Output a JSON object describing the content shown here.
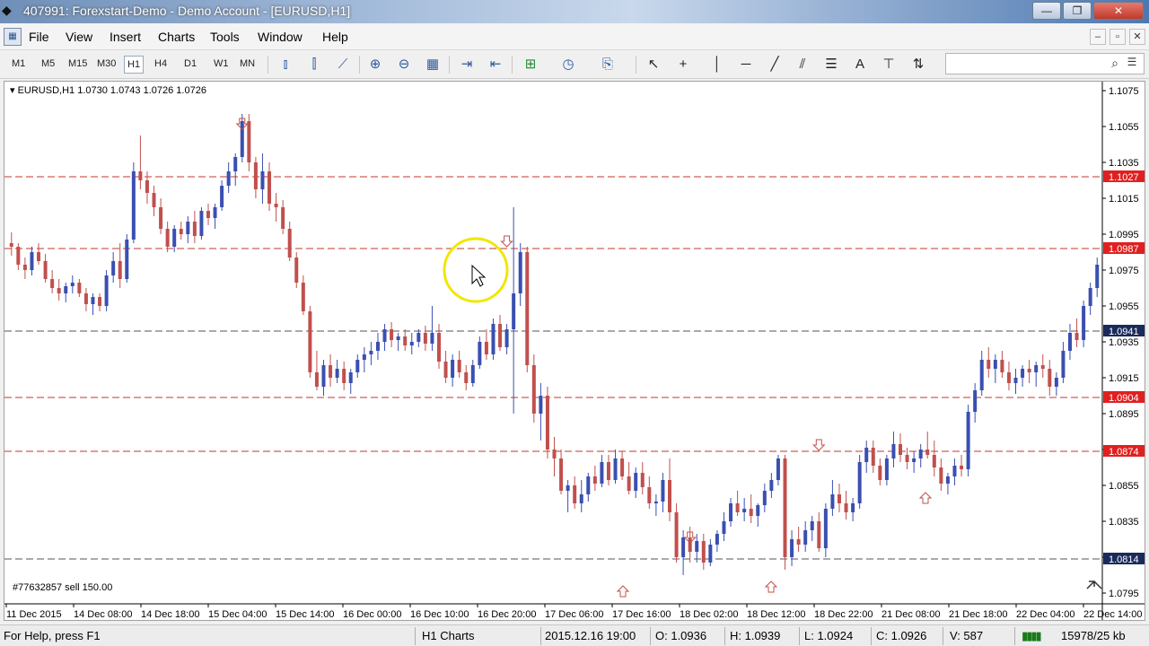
{
  "window": {
    "title": "407991: Forexstart-Demo - Demo Account - [EURUSD,H1]",
    "minimize": "—",
    "maximize": "❐",
    "close": "✕"
  },
  "menu": {
    "items": [
      "File",
      "View",
      "Insert",
      "Charts",
      "Tools",
      "Window",
      "Help"
    ],
    "mdi": [
      "–",
      "▫",
      "✕"
    ]
  },
  "toolbar": {
    "timeframes": [
      "M1",
      "M5",
      "M15",
      "M30",
      "H1",
      "H4",
      "D1",
      "W1",
      "MN"
    ],
    "active_timeframe": "H1",
    "search_placeholder": ""
  },
  "chart": {
    "info": "EURUSD,H1  1.0730 1.0743 1.0726 1.0726",
    "trade_label": "#77632857 sell 150.00",
    "colors": {
      "bull": "#3a4fb0",
      "bear": "#c0504d",
      "hline_red": "#c0392b",
      "hline_dark": "#555555",
      "price_red_bg": "#e02020",
      "price_dark_bg": "#1a2a5a",
      "cursor_circle": "#f2e600"
    }
  },
  "chart_data": {
    "type": "candlestick",
    "symbol": "EURUSD",
    "timeframe": "H1",
    "ylim": [
      1.0795,
      1.1075
    ],
    "y_ticks": [
      "1.1075",
      "1.1055",
      "1.1035",
      "1.1015",
      "1.0995",
      "1.0975",
      "1.0955",
      "1.0935",
      "1.0915",
      "1.0895",
      "1.0875",
      "1.0855",
      "1.0835",
      "1.0815",
      "1.0795"
    ],
    "x_ticks": [
      "11 Dec 2015",
      "14 Dec 08:00",
      "14 Dec 18:00",
      "15 Dec 04:00",
      "15 Dec 14:00",
      "16 Dec 00:00",
      "16 Dec 10:00",
      "16 Dec 20:00",
      "17 Dec 06:00",
      "17 Dec 16:00",
      "18 Dec 02:00",
      "18 Dec 12:00",
      "18 Dec 22:00",
      "21 Dec 08:00",
      "21 Dec 18:00",
      "22 Dec 04:00",
      "22 Dec 14:00"
    ],
    "horizontal_lines": [
      {
        "price": "1.1027",
        "style": "red"
      },
      {
        "price": "1.0987",
        "style": "red"
      },
      {
        "price": "1.0941",
        "style": "dark"
      },
      {
        "price": "1.0904",
        "style": "red"
      },
      {
        "price": "1.0874",
        "style": "red"
      },
      {
        "price": "1.0814",
        "style": "dark"
      }
    ],
    "candles": [
      [
        1.099,
        1.0996,
        1.0983,
        1.0988
      ],
      [
        1.0988,
        1.099,
        1.0975,
        1.0978
      ],
      [
        1.0978,
        1.0982,
        1.097,
        1.0975
      ],
      [
        1.0975,
        1.0988,
        1.0972,
        1.0985
      ],
      [
        1.0985,
        1.099,
        1.0978,
        1.098
      ],
      [
        1.098,
        1.0984,
        1.0968,
        1.097
      ],
      [
        1.097,
        1.0975,
        1.0962,
        1.0965
      ],
      [
        1.0965,
        1.097,
        1.0958,
        1.0962
      ],
      [
        1.0962,
        1.0968,
        1.0957,
        1.0966
      ],
      [
        1.0966,
        1.0972,
        1.0962,
        1.0968
      ],
      [
        1.0968,
        1.097,
        1.096,
        1.0962
      ],
      [
        1.0962,
        1.0965,
        1.0952,
        1.0956
      ],
      [
        1.0956,
        1.0962,
        1.095,
        1.096
      ],
      [
        1.096,
        1.0962,
        1.0952,
        1.0955
      ],
      [
        1.0955,
        1.0975,
        1.0952,
        1.0972
      ],
      [
        1.0972,
        1.0985,
        1.0968,
        1.098
      ],
      [
        1.098,
        1.099,
        1.0965,
        1.097
      ],
      [
        1.097,
        1.0995,
        1.0968,
        1.0992
      ],
      [
        1.0992,
        1.1035,
        1.099,
        1.103
      ],
      [
        1.103,
        1.105,
        1.102,
        1.1025
      ],
      [
        1.1025,
        1.103,
        1.1012,
        1.1018
      ],
      [
        1.1018,
        1.1022,
        1.1005,
        1.101
      ],
      [
        1.101,
        1.1015,
        1.0995,
        1.0998
      ],
      [
        1.0998,
        1.1002,
        1.0985,
        1.0988
      ],
      [
        1.0988,
        1.1,
        1.0985,
        1.0998
      ],
      [
        1.0998,
        1.1002,
        1.0992,
        1.0995
      ],
      [
        1.0995,
        1.1005,
        1.099,
        1.1002
      ],
      [
        1.1002,
        1.1008,
        1.099,
        1.0994
      ],
      [
        1.0994,
        1.101,
        1.0992,
        1.1008
      ],
      [
        1.1008,
        1.1012,
        1.1,
        1.1004
      ],
      [
        1.1004,
        1.1012,
        1.0998,
        1.101
      ],
      [
        1.101,
        1.1025,
        1.1008,
        1.1022
      ],
      [
        1.1022,
        1.1035,
        1.1018,
        1.103
      ],
      [
        1.103,
        1.104,
        1.1022,
        1.1038
      ],
      [
        1.1038,
        1.1062,
        1.1035,
        1.1058
      ],
      [
        1.1058,
        1.1062,
        1.103,
        1.1035
      ],
      [
        1.1035,
        1.1038,
        1.1015,
        1.102
      ],
      [
        1.102,
        1.104,
        1.1012,
        1.103
      ],
      [
        1.103,
        1.1035,
        1.1008,
        1.1012
      ],
      [
        1.1012,
        1.1018,
        1.1002,
        1.101
      ],
      [
        1.101,
        1.1014,
        1.0995,
        1.0998
      ],
      [
        1.0998,
        1.1002,
        1.098,
        1.0982
      ],
      [
        1.0982,
        1.0985,
        1.0965,
        1.0968
      ],
      [
        1.0968,
        1.0972,
        1.095,
        1.0952
      ],
      [
        1.0952,
        1.0955,
        1.0915,
        1.0918
      ],
      [
        1.0918,
        1.093,
        1.0908,
        1.091
      ],
      [
        1.091,
        1.0925,
        1.0905,
        1.0922
      ],
      [
        1.0922,
        1.0928,
        1.091,
        1.0915
      ],
      [
        1.0915,
        1.0925,
        1.0912,
        1.092
      ],
      [
        1.092,
        1.0924,
        1.0908,
        1.0912
      ],
      [
        1.0912,
        1.092,
        1.0906,
        1.0918
      ],
      [
        1.0918,
        1.0928,
        1.0915,
        1.0925
      ],
      [
        1.0925,
        1.0932,
        1.0918,
        1.0928
      ],
      [
        1.0928,
        1.0935,
        1.0922,
        1.093
      ],
      [
        1.093,
        1.094,
        1.0925,
        1.0935
      ],
      [
        1.0935,
        1.0945,
        1.093,
        1.0942
      ],
      [
        1.0942,
        1.0946,
        1.0932,
        1.0936
      ],
      [
        1.0936,
        1.094,
        1.093,
        1.0938
      ],
      [
        1.0938,
        1.0942,
        1.093,
        1.0933
      ],
      [
        1.0933,
        1.094,
        1.0928,
        1.0935
      ],
      [
        1.0935,
        1.0942,
        1.0932,
        1.094
      ],
      [
        1.094,
        1.0944,
        1.093,
        1.0934
      ],
      [
        1.0934,
        1.0955,
        1.093,
        1.094
      ],
      [
        1.094,
        1.0945,
        1.092,
        1.0924
      ],
      [
        1.0924,
        1.093,
        1.0912,
        1.0915
      ],
      [
        1.0915,
        1.0928,
        1.091,
        1.0925
      ],
      [
        1.0925,
        1.093,
        1.0915,
        1.0918
      ],
      [
        1.0918,
        1.0922,
        1.0908,
        1.0912
      ],
      [
        1.0912,
        1.0925,
        1.091,
        1.0922
      ],
      [
        1.0922,
        1.0938,
        1.092,
        1.0935
      ],
      [
        1.0935,
        1.0942,
        1.0925,
        1.0928
      ],
      [
        1.0928,
        1.0948,
        1.0925,
        1.0945
      ],
      [
        1.0945,
        1.095,
        1.093,
        1.0932
      ],
      [
        1.0932,
        1.0945,
        1.0928,
        1.0942
      ],
      [
        1.0942,
        1.101,
        1.0895,
        1.0962
      ],
      [
        1.0962,
        1.099,
        1.0955,
        1.0985
      ],
      [
        1.0985,
        1.0988,
        1.0918,
        1.0922
      ],
      [
        1.0922,
        1.0928,
        1.089,
        1.0895
      ],
      [
        1.0895,
        1.0912,
        1.088,
        1.0905
      ],
      [
        1.0905,
        1.091,
        1.087,
        1.0875
      ],
      [
        1.0875,
        1.0882,
        1.086,
        1.087
      ],
      [
        1.087,
        1.0875,
        1.085,
        1.0852
      ],
      [
        1.0852,
        1.0858,
        1.084,
        1.0855
      ],
      [
        1.0855,
        1.086,
        1.0842,
        1.0845
      ],
      [
        1.0845,
        1.0858,
        1.084,
        1.085
      ],
      [
        1.085,
        1.0862,
        1.0846,
        1.086
      ],
      [
        1.086,
        1.0866,
        1.0852,
        1.0856
      ],
      [
        1.0856,
        1.0872,
        1.0854,
        1.0868
      ],
      [
        1.0868,
        1.0872,
        1.0855,
        1.0858
      ],
      [
        1.0858,
        1.0875,
        1.0856,
        1.087
      ],
      [
        1.087,
        1.0874,
        1.0858,
        1.086
      ],
      [
        1.086,
        1.0868,
        1.085,
        1.0852
      ],
      [
        1.0852,
        1.0865,
        1.0848,
        1.0862
      ],
      [
        1.0862,
        1.0868,
        1.085,
        1.0854
      ],
      [
        1.0854,
        1.086,
        1.0842,
        1.0845
      ],
      [
        1.0845,
        1.085,
        1.0838,
        1.0846
      ],
      [
        1.0846,
        1.0862,
        1.084,
        1.0858
      ],
      [
        1.0858,
        1.087,
        1.0835,
        1.084
      ],
      [
        1.084,
        1.0845,
        1.0812,
        1.0815
      ],
      [
        1.0815,
        1.083,
        1.0805,
        1.0826
      ],
      [
        1.0826,
        1.0832,
        1.0812,
        1.0818
      ],
      [
        1.0818,
        1.0828,
        1.0812,
        1.0824
      ],
      [
        1.0824,
        1.0828,
        1.0808,
        1.0812
      ],
      [
        1.0812,
        1.0825,
        1.081,
        1.0822
      ],
      [
        1.0822,
        1.083,
        1.0818,
        1.0828
      ],
      [
        1.0828,
        1.084,
        1.0824,
        1.0835
      ],
      [
        1.0835,
        1.0848,
        1.0832,
        1.0845
      ],
      [
        1.0845,
        1.0852,
        1.0838,
        1.084
      ],
      [
        1.084,
        1.0848,
        1.0835,
        1.0842
      ],
      [
        1.0842,
        1.085,
        1.0834,
        1.0838
      ],
      [
        1.0838,
        1.0845,
        1.0832,
        1.0844
      ],
      [
        1.0844,
        1.0856,
        1.084,
        1.0852
      ],
      [
        1.0852,
        1.0862,
        1.0848,
        1.0858
      ],
      [
        1.0858,
        1.0872,
        1.0855,
        1.087
      ],
      [
        1.087,
        1.0872,
        1.0808,
        1.0815
      ],
      [
        1.0815,
        1.083,
        1.081,
        1.0825
      ],
      [
        1.0825,
        1.0832,
        1.0818,
        1.0822
      ],
      [
        1.0822,
        1.0835,
        1.0818,
        1.083
      ],
      [
        1.083,
        1.0838,
        1.0824,
        1.0835
      ],
      [
        1.0835,
        1.084,
        1.0818,
        1.082
      ],
      [
        1.082,
        1.0845,
        1.0815,
        1.0842
      ],
      [
        1.0842,
        1.0858,
        1.0838,
        1.085
      ],
      [
        1.085,
        1.0856,
        1.084,
        1.0845
      ],
      [
        1.0845,
        1.0852,
        1.0836,
        1.084
      ],
      [
        1.084,
        1.0848,
        1.0835,
        1.0845
      ],
      [
        1.0845,
        1.0872,
        1.0842,
        1.0868
      ],
      [
        1.0868,
        1.088,
        1.0862,
        1.0876
      ],
      [
        1.0876,
        1.088,
        1.0862,
        1.0866
      ],
      [
        1.0866,
        1.087,
        1.0855,
        1.0858
      ],
      [
        1.0858,
        1.0872,
        1.0855,
        1.087
      ],
      [
        1.087,
        1.0885,
        1.0865,
        1.0878
      ],
      [
        1.0878,
        1.0884,
        1.0868,
        1.0872
      ],
      [
        1.0872,
        1.0876,
        1.0864,
        1.0868
      ],
      [
        1.0868,
        1.0874,
        1.0862,
        1.087
      ],
      [
        1.087,
        1.0878,
        1.0865,
        1.0875
      ],
      [
        1.0875,
        1.0885,
        1.087,
        1.0872
      ],
      [
        1.0872,
        1.088,
        1.086,
        1.0865
      ],
      [
        1.0865,
        1.087,
        1.0852,
        1.0856
      ],
      [
        1.0856,
        1.0862,
        1.085,
        1.086
      ],
      [
        1.086,
        1.087,
        1.0855,
        1.0866
      ],
      [
        1.0866,
        1.0872,
        1.086,
        1.0864
      ],
      [
        1.0864,
        1.09,
        1.086,
        1.0896
      ],
      [
        1.0896,
        1.0912,
        1.089,
        1.0908
      ],
      [
        1.0908,
        1.093,
        1.0905,
        1.0925
      ],
      [
        1.0925,
        1.0932,
        1.0915,
        1.092
      ],
      [
        1.092,
        1.0928,
        1.0912,
        1.0925
      ],
      [
        1.0925,
        1.093,
        1.0915,
        1.0918
      ],
      [
        1.0918,
        1.0924,
        1.0908,
        1.0912
      ],
      [
        1.0912,
        1.092,
        1.0906,
        1.0915
      ],
      [
        1.0915,
        1.0922,
        1.091,
        1.092
      ],
      [
        1.092,
        1.0925,
        1.0912,
        1.0918
      ],
      [
        1.0918,
        1.0924,
        1.091,
        1.0922
      ],
      [
        1.0922,
        1.0928,
        1.0915,
        1.092
      ],
      [
        1.092,
        1.0925,
        1.0905,
        1.091
      ],
      [
        1.091,
        1.0918,
        1.0905,
        1.0915
      ],
      [
        1.0915,
        1.0935,
        1.0912,
        1.093
      ],
      [
        1.093,
        1.0945,
        1.0925,
        1.094
      ],
      [
        1.094,
        1.0948,
        1.0932,
        1.0936
      ],
      [
        1.0936,
        1.0958,
        1.0932,
        1.0955
      ],
      [
        1.0955,
        1.0968,
        1.095,
        1.0965
      ],
      [
        1.0965,
        1.0982,
        1.096,
        1.0978
      ]
    ],
    "annotations": [
      "sell arrow",
      "buy arrow"
    ]
  },
  "statusbar": {
    "help": "For Help, press F1",
    "profile": "H1 Charts",
    "datetime": "2015.12.16 19:00",
    "open": "O: 1.0936",
    "high": "H: 1.0939",
    "low": "L: 1.0924",
    "close": "C: 1.0926",
    "volume": "V: 587",
    "traffic": "15978/25 kb"
  }
}
